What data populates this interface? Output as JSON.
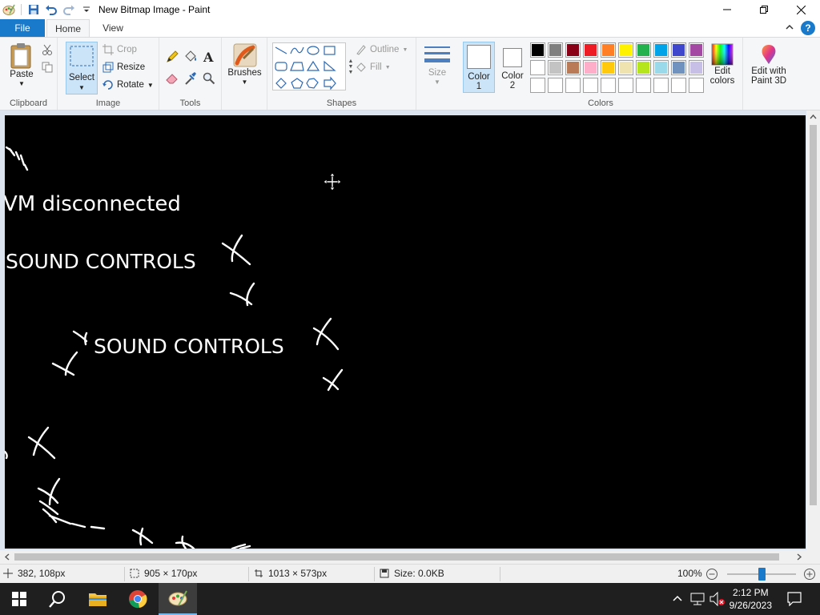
{
  "window": {
    "title": "New Bitmap Image - Paint"
  },
  "ribbon_tabs": {
    "file": "File",
    "home": "Home",
    "view": "View"
  },
  "clipboard": {
    "paste": "Paste",
    "group_label": "Clipboard"
  },
  "image": {
    "select": "Select",
    "crop": "Crop",
    "resize": "Resize",
    "rotate": "Rotate",
    "group_label": "Image"
  },
  "tools": {
    "group_label": "Tools"
  },
  "brushes": {
    "label": "Brushes"
  },
  "shapes": {
    "outline": "Outline",
    "fill": "Fill",
    "group_label": "Shapes"
  },
  "size": {
    "label": "Size"
  },
  "colors": {
    "color1_line1": "Color",
    "color1_line2": "1",
    "color2_line1": "Color",
    "color2_line2": "2",
    "edit_line1": "Edit",
    "edit_line2": "colors",
    "paint3d_line1": "Edit with",
    "paint3d_line2": "Paint 3D",
    "group_label": "Colors",
    "color1_value": "#ffffff",
    "color2_value": "#ffffff",
    "palette": [
      "#000000",
      "#7f7f7f",
      "#880015",
      "#ed1c24",
      "#ff7f27",
      "#fff200",
      "#22b14c",
      "#00a2e8",
      "#3f48cc",
      "#a349a4",
      "#ffffff",
      "#c3c3c3",
      "#b97a57",
      "#ffaec9",
      "#ffc90e",
      "#efe4b0",
      "#b5e61d",
      "#99d9ea",
      "#7092be",
      "#c8bfe7",
      "#ffffff",
      "#ffffff",
      "#ffffff",
      "#ffffff",
      "#ffffff",
      "#ffffff",
      "#ffffff",
      "#ffffff",
      "#ffffff",
      "#ffffff"
    ]
  },
  "canvas": {
    "background": "#000000",
    "text_vm": "VM disconnected",
    "text_sound1": "SOUND CONTROLS",
    "text_sound2": "SOUND CONTROLS"
  },
  "status": {
    "cursor_pos": "382, 108px",
    "selection_size": "905 × 170px",
    "image_size": "1013 × 573px",
    "file_size": "Size: 0.0KB",
    "zoom": "100%",
    "zoom_fraction": 0.5
  },
  "taskbar": {
    "time": "2:12 PM",
    "date": "9/26/2023"
  }
}
